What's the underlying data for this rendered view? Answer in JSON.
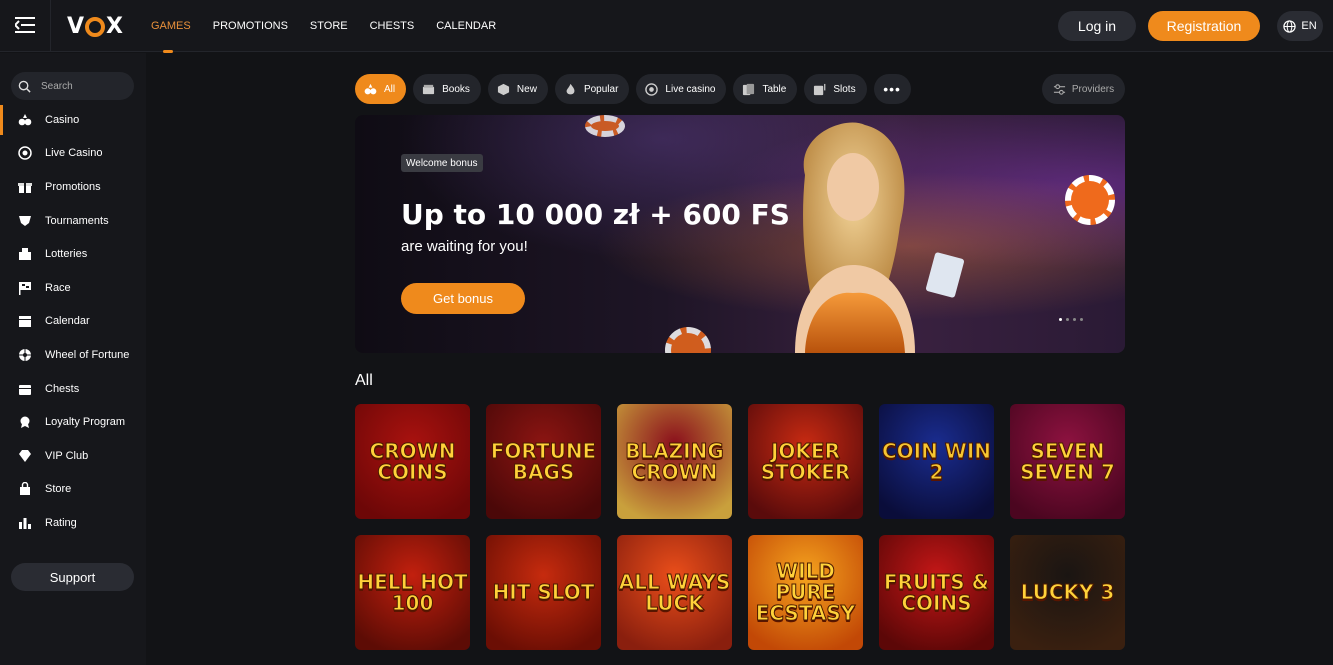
{
  "header": {
    "logo_text_v": "V",
    "logo_text_x": "X",
    "nav": [
      "GAMES",
      "PROMOTIONS",
      "STORE",
      "CHESTS",
      "CALENDAR"
    ],
    "login_label": "Log in",
    "register_label": "Registration",
    "lang": "EN"
  },
  "sidebar": {
    "search_placeholder": "Search",
    "items": [
      {
        "label": "Casino",
        "icon": "casino-icon"
      },
      {
        "label": "Live Casino",
        "icon": "live-casino-icon"
      },
      {
        "label": "Promotions",
        "icon": "promotions-icon"
      },
      {
        "label": "Tournaments",
        "icon": "tournaments-icon"
      },
      {
        "label": "Lotteries",
        "icon": "lotteries-icon"
      },
      {
        "label": "Race",
        "icon": "race-icon"
      },
      {
        "label": "Calendar",
        "icon": "calendar-icon"
      },
      {
        "label": "Wheel of Fortune",
        "icon": "wheel-icon"
      },
      {
        "label": "Chests",
        "icon": "chests-icon"
      },
      {
        "label": "Loyalty Program",
        "icon": "loyalty-icon"
      },
      {
        "label": "VIP Club",
        "icon": "vip-icon"
      },
      {
        "label": "Store",
        "icon": "store-icon"
      },
      {
        "label": "Rating",
        "icon": "rating-icon"
      }
    ],
    "support_label": "Support"
  },
  "filters": {
    "pills": [
      "All",
      "Books",
      "New",
      "Popular",
      "Live casino",
      "Table",
      "Slots"
    ],
    "more": "•••",
    "providers_label": "Providers"
  },
  "banner": {
    "tag": "Welcome bonus",
    "title": "Up to 10 000 zł + 600 FS",
    "subtitle": "are waiting for you!",
    "button": "Get bonus"
  },
  "section": {
    "title": "All",
    "games": [
      {
        "name": "CROWN COINS",
        "colors": [
          "#a9120f",
          "#6d0707"
        ]
      },
      {
        "name": "FORTUNE BAGS",
        "colors": [
          "#8c1512",
          "#4b0808"
        ]
      },
      {
        "name": "BLAZING CROWN",
        "colors": [
          "#8a0e1c",
          "#c9a03c"
        ]
      },
      {
        "name": "JOKER STOKER",
        "colors": [
          "#c72a12",
          "#5a0b0b"
        ]
      },
      {
        "name": "COIN WIN 2",
        "colors": [
          "#1a2c8f",
          "#0a0d3a"
        ]
      },
      {
        "name": "SEVEN SEVEN 7",
        "colors": [
          "#8e1240",
          "#4b0620"
        ]
      },
      {
        "name": "HELL HOT 100",
        "colors": [
          "#c2200e",
          "#5d0c05"
        ]
      },
      {
        "name": "HIT SLOT",
        "colors": [
          "#c62b0e",
          "#6b0e04"
        ]
      },
      {
        "name": "ALL WAYS LUCK",
        "colors": [
          "#ea4e1a",
          "#8a1f0e"
        ]
      },
      {
        "name": "WILD PURE ECSTASY",
        "colors": [
          "#f5a31e",
          "#c24806"
        ]
      },
      {
        "name": "FRUITS & COINS",
        "colors": [
          "#c41717",
          "#5c0707"
        ]
      },
      {
        "name": "LUCKY 3",
        "colors": [
          "#1a1512",
          "#3a2010"
        ]
      }
    ]
  }
}
